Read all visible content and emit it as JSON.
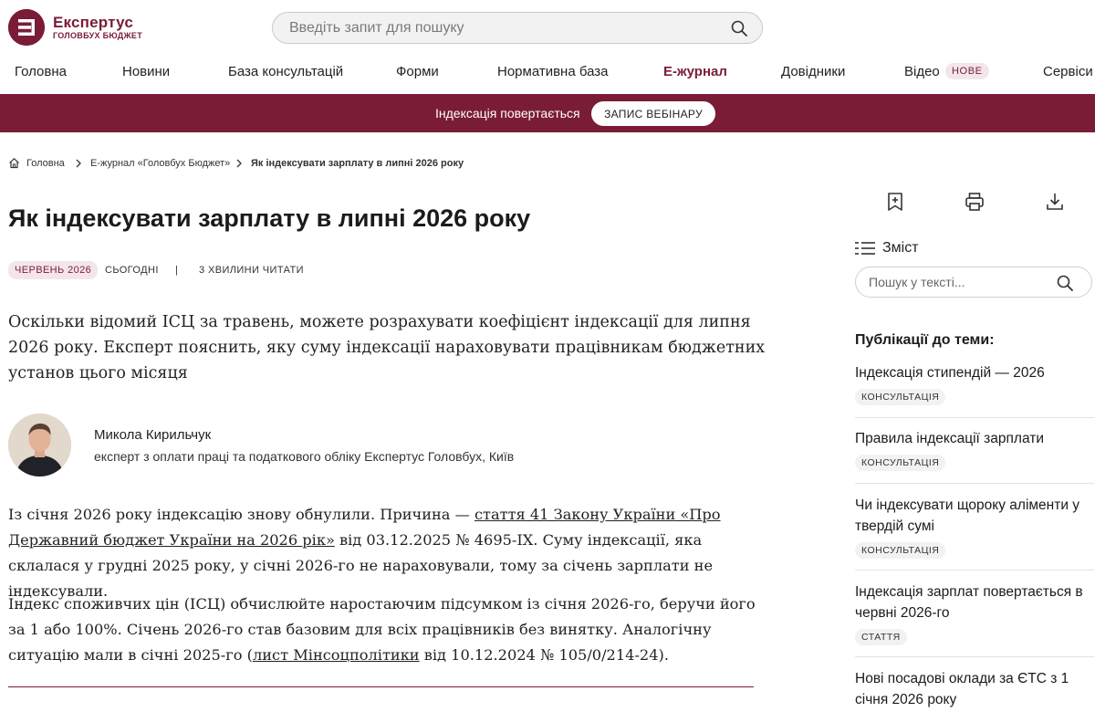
{
  "header": {
    "logo_name": "Експертус",
    "logo_sub": "ГОЛОВБУХ БЮДЖЕТ",
    "search_placeholder": "Введіть запит для пошуку",
    "brand_color": "#7a1c36"
  },
  "nav": {
    "items": [
      "Головна",
      "Новини",
      "База консультацій",
      "Форми",
      "Нормативна база",
      "Е-журнал",
      "Довідники",
      "Відео",
      "Сервіси"
    ],
    "active": "Е-журнал",
    "new_badge": "НОВЕ"
  },
  "promo": {
    "text": "Індексація повертається",
    "button_label": "ЗАПИС ВЕБІНАРУ"
  },
  "breadcrumb": {
    "items": [
      "Головна",
      "Е-журнал «Головбух Бюджет»",
      "Як індексувати зарплату в липні 2026 року"
    ]
  },
  "article": {
    "title": "Як індексувати зарплату в липні 2026 року",
    "meta": {
      "date": "ЧЕРВЕНЬ 2026",
      "updated": "СЬОГОДНІ",
      "separator": "|",
      "read_time": "3 ХВИЛИНИ ЧИТАТИ"
    },
    "lead": "Оскільки відомий ІСЦ за травень, можете розрахувати коефіцієнт індексації для липня 2026 року. Експерт пояснить, яку суму індексації нараховувати працівникам бюджетних установ цього місяця",
    "author": {
      "name": "Микола Кирильчук",
      "role": "експерт з оплати праці та податкового обліку Експертус Головбух, Київ"
    },
    "p1_before": "Із січня 2026 року індексацію знову обнулили. Причина — ",
    "p1_link": "стаття 41 Закону України «Про Державний бюджет України на 2026 рік»",
    "p1_after": " від 03.12.2025 № 4695-IX. Суму індексації, яка склалася у грудні 2025 року, у січні 2026-го не нараховували, тому за січень зарплати не індексували.",
    "p2_before": "Індекс споживчих цін (ІСЦ) обчислюйте наростаючим підсумком із січня 2026-го, беручи його за 1 або 100%. Січень 2026-го став базовим для всіх працівників без винятку. Аналогічну ситуацію мали в січні 2025-го (",
    "p2_link": "лист Мінсоцполітики",
    "p2_after": " від 10.12.2024 № 105/0/214-24)."
  },
  "sidebar": {
    "toc_label": "Зміст",
    "search_placeholder": "Пошук у тексті...",
    "related_title": "Публікації до теми:",
    "related": [
      {
        "title": "Індексація стипендій — 2026",
        "tag": "КОНСУЛЬТАЦІЯ"
      },
      {
        "title": "Правила індексації зарплати",
        "tag": "КОНСУЛЬТАЦІЯ"
      },
      {
        "title": "Чи індексувати щороку аліменти у твердій сумі",
        "tag": "КОНСУЛЬТАЦІЯ"
      },
      {
        "title": "Індексація зарплат повертається в червні 2026-го",
        "tag": "СТАТТЯ"
      },
      {
        "title": "Нові посадові оклади за ЄТС з 1 січня 2026 року",
        "tag": ""
      }
    ]
  }
}
